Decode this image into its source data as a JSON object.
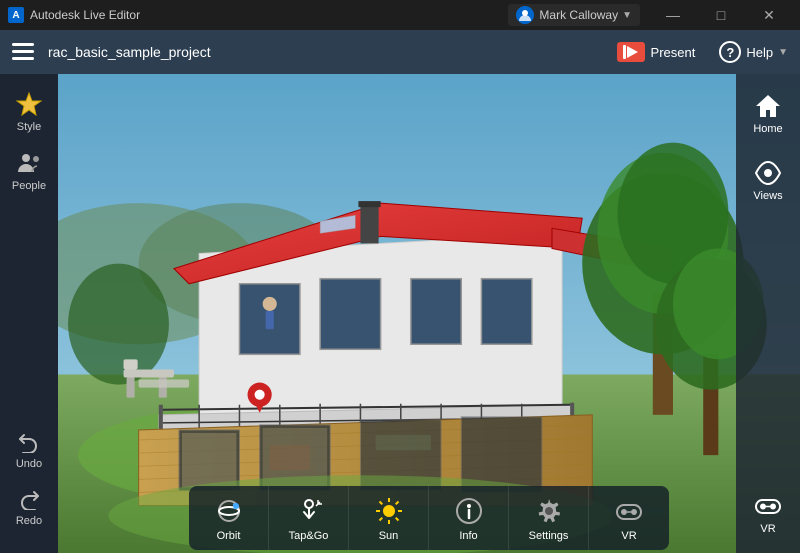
{
  "titlebar": {
    "app_name": "Autodesk Live Editor",
    "user_name": "Mark Calloway",
    "minimize": "—",
    "maximize": "□",
    "close": "✕"
  },
  "topbar": {
    "project_title": "rac_basic_sample_project",
    "present_label": "Present",
    "help_label": "Help"
  },
  "left_sidebar": {
    "style_label": "Style",
    "people_label": "People",
    "undo_label": "Undo",
    "redo_label": "Redo"
  },
  "right_sidebar": {
    "home_label": "Home",
    "views_label": "Views",
    "vr_label": "VR"
  },
  "bottom_toolbar": {
    "orbit_label": "Orbit",
    "tapgo_label": "Tap&Go",
    "sun_label": "Sun",
    "info_label": "Info",
    "settings_label": "Settings",
    "vr_label": "VR"
  }
}
